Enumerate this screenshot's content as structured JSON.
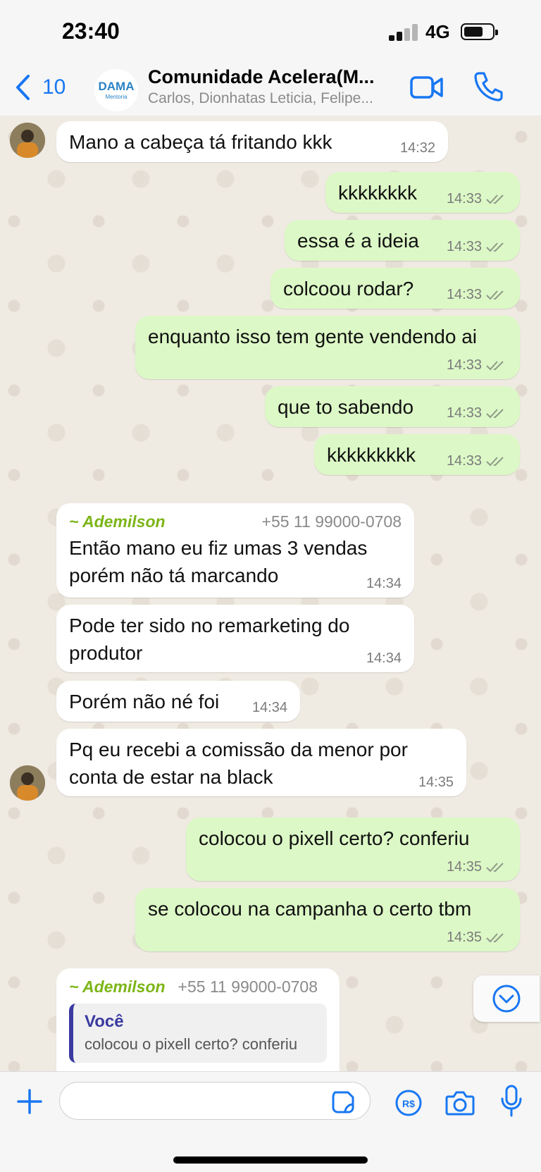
{
  "status_bar": {
    "time": "23:40",
    "network": "4G"
  },
  "header": {
    "back_count": "10",
    "title": "Comunidade Acelera(M...",
    "subtitle": "Carlos, Dionhatas Leticia, Felipe...",
    "avatar_text": "DAMA",
    "avatar_subtext": "Mentoria"
  },
  "messages": [
    {
      "dir": "in",
      "text": "Mano a cabeça tá fritando kkk",
      "time": "14:32"
    },
    {
      "dir": "out",
      "text": "kkkkkkkk",
      "time": "14:33"
    },
    {
      "dir": "out",
      "text": "essa é a ideia",
      "time": "14:33"
    },
    {
      "dir": "out",
      "text": "colcoou rodar?",
      "time": "14:33"
    },
    {
      "dir": "out",
      "text": "enquanto isso tem gente vendendo ai",
      "time": "14:33"
    },
    {
      "dir": "out",
      "text": "que to sabendo",
      "time": "14:33"
    },
    {
      "dir": "out",
      "text": "kkkkkkkkk",
      "time": "14:33"
    },
    {
      "dir": "in",
      "sender": "~ Ademilson",
      "phone": "+55 11 99000-0708",
      "text": "Então mano eu fiz umas 3 vendas porém não tá marcando",
      "time": "14:34"
    },
    {
      "dir": "in",
      "text": "Pode ter sido no remarketing do produtor",
      "time": "14:34"
    },
    {
      "dir": "in",
      "text": "Porém não né foi",
      "time": "14:34"
    },
    {
      "dir": "in",
      "text": "Pq eu recebi a comissão da menor por conta de estar na black",
      "time": "14:35"
    },
    {
      "dir": "out",
      "text": "colocou o pixell certo? conferiu",
      "time": "14:35"
    },
    {
      "dir": "out",
      "text": "se colocou na campanha o certo tbm",
      "time": "14:35"
    },
    {
      "dir": "in",
      "sender": "~ Ademilson",
      "phone": "+55 11 99000-0708",
      "quote_author": "Você",
      "quote_text": "colocou o pixell certo? conferiu"
    }
  ],
  "input": {
    "placeholder": ""
  },
  "colors": {
    "outgoing": "#dcf8c6",
    "incoming": "#ffffff",
    "accent": "#1877f2",
    "sender": "#7cb518"
  },
  "icons": [
    "chevron-left-icon",
    "video-icon",
    "phone-icon",
    "plus-icon",
    "sticker-icon",
    "payment-icon",
    "camera-icon",
    "microphone-icon",
    "chevron-down-icon",
    "double-check-icon"
  ]
}
